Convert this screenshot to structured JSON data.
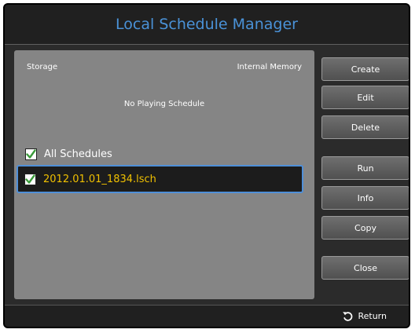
{
  "window": {
    "title": "Local Schedule Manager"
  },
  "storage": {
    "label": "Storage",
    "value": "Internal Memory"
  },
  "status": "No Playing Schedule",
  "schedules": {
    "all_label": "All Schedules",
    "all_checked": true,
    "items": [
      {
        "name": "2012.01.01_1834.lsch",
        "checked": true,
        "selected": true
      }
    ]
  },
  "buttons": {
    "create": "Create",
    "edit": "Edit",
    "delete": "Delete",
    "run": "Run",
    "info": "Info",
    "copy": "Copy",
    "close": "Close"
  },
  "footer": {
    "return_label": "Return",
    "return_icon": "return-arrow-icon"
  },
  "colors": {
    "title": "#4a92d8",
    "selected_text": "#f0c000",
    "selection_border": "#4f8fd8",
    "check": "#3a9b3a"
  }
}
